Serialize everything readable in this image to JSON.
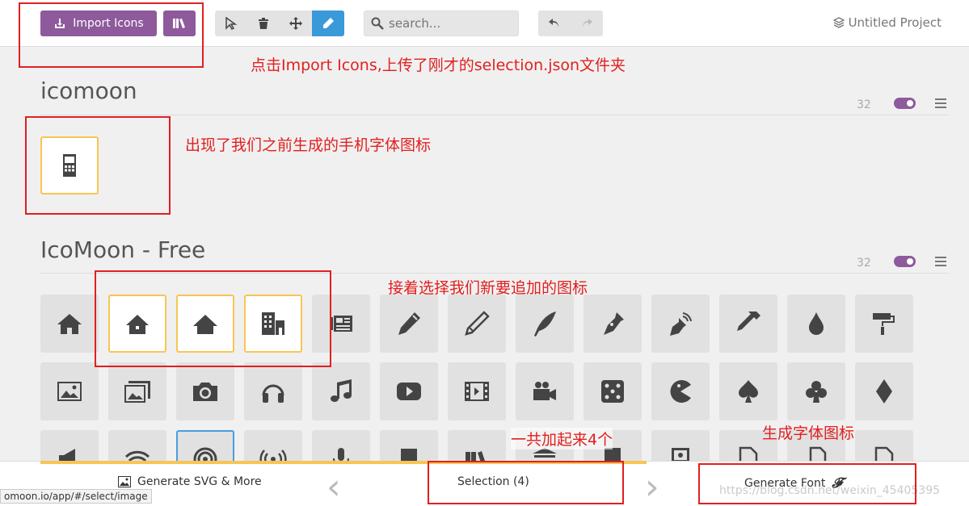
{
  "header": {
    "import_label": "Import Icons",
    "search_placeholder": "search...",
    "project_name": "Untitled Project"
  },
  "annotations": {
    "import_note": "点击Import Icons,上传了刚才的selection.json文件夹",
    "phone_note": "出现了我们之前生成的手机字体图标",
    "select_note": "接着选择我们新要追加的图标",
    "count_note": "一共加起来4个",
    "font_note": "生成字体图标"
  },
  "sets": [
    {
      "title": "icomoon",
      "count": "32"
    },
    {
      "title": "IcoMoon - Free",
      "count": "32"
    }
  ],
  "icons_row1": [
    "home-icon",
    "home2-icon",
    "home3-icon",
    "office-icon",
    "newspaper-icon",
    "pencil-icon",
    "pencil2-icon",
    "quill-icon",
    "pen-icon",
    "blog-icon",
    "eyedropper-icon",
    "droplet-icon",
    "paint-format-icon"
  ],
  "icons_row2": [
    "image-icon",
    "images-icon",
    "camera-icon",
    "headphones-icon",
    "music-icon",
    "play-icon",
    "film-icon",
    "video-camera-icon",
    "dice-icon",
    "pacman-icon",
    "spades-icon",
    "clubs-icon",
    "diamonds-icon"
  ],
  "footer": {
    "generate_svg": "Generate SVG & More",
    "selection": "Selection (4)",
    "generate_font": "Generate Font"
  },
  "url_tip": "omoon.io/app/#/select/image",
  "watermark": "https://blog.csdn.net/weixin_45405395",
  "colors": {
    "accent": "#8e5a9c",
    "selected": "#f7c554",
    "annotation": "#e21f1f",
    "active_tool": "#3a9ad9"
  }
}
